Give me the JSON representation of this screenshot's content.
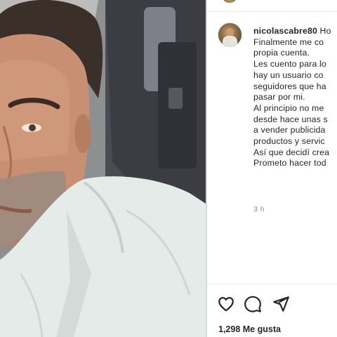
{
  "post": {
    "username": "nicolascabre80",
    "caption_first_line": "Ho",
    "caption_lines": [
      "Finalmente me co",
      "propia cuenta.",
      "Les cuento para lo",
      "hay un usuario co",
      "seguidores que ha",
      "pasar por mi.",
      "Al principio no me",
      "desde hace unas s",
      "a vender publicida",
      "productos y servic",
      "Así que decidí crea",
      "Prometo hacer tod"
    ],
    "timestamp": "3 h",
    "likes": "1,298 Me gusta"
  },
  "icons": {
    "like": "heart-icon",
    "comment": "comment-bubble-icon",
    "share": "paper-plane-icon"
  },
  "colors": {
    "text": "#262626",
    "muted": "#8e8e8e",
    "divider": "#e6e6e6"
  }
}
